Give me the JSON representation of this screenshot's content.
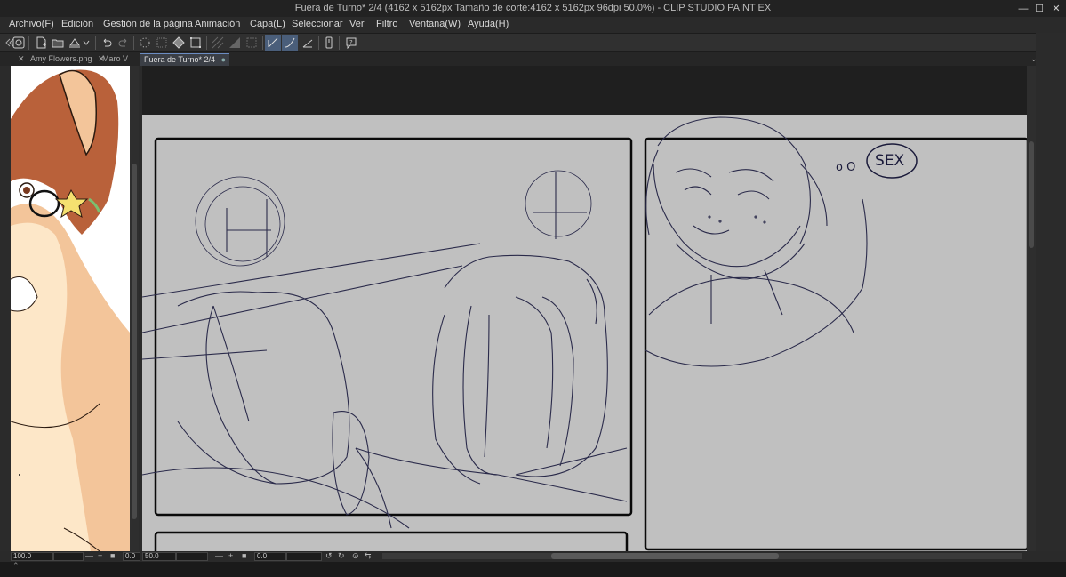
{
  "window": {
    "title": "Fuera de Turno* 2/4 (4162 x 5162px Tamaño de corte:4162 x 5162px 96dpi 50.0%)  - CLIP STUDIO PAINT EX",
    "minimize": "—",
    "maximize": "☐",
    "close": "✕"
  },
  "menu": {
    "items": [
      "Archivo(F)",
      "Edición",
      "Gestión de la página",
      "Animación",
      "Capa(L)",
      "Seleccionar",
      "Ver",
      "Filtro",
      "Ventana(W)",
      "Ayuda(H)"
    ]
  },
  "tabs": {
    "items": [
      {
        "label": "Amy Flowers.png",
        "close": "✕"
      },
      {
        "label": "Maro V"
      },
      {
        "label": "Fuera de Turno* 2/4",
        "close": "●"
      }
    ],
    "tab_close_left": "✕"
  },
  "statusbar": {
    "left_zoom": "100.0",
    "left_angle": "0.0",
    "main_zoom": "50.0",
    "main_angle": "0.0"
  },
  "canvas_text": {
    "speech": "SEX",
    "dots": "o O"
  },
  "colors": {
    "paper": "#c0c0c0",
    "line": "#2a2a4a",
    "panel_border": "#0a0a0a",
    "accent": "#6b8cc2"
  },
  "icons": [
    "communication-icon",
    "new-file-icon",
    "open-folder-icon",
    "save-icon",
    "undo-icon",
    "redo-icon",
    "transform-icon",
    "fill-icon",
    "pen-icon",
    "phone-icon",
    "help-icon"
  ]
}
